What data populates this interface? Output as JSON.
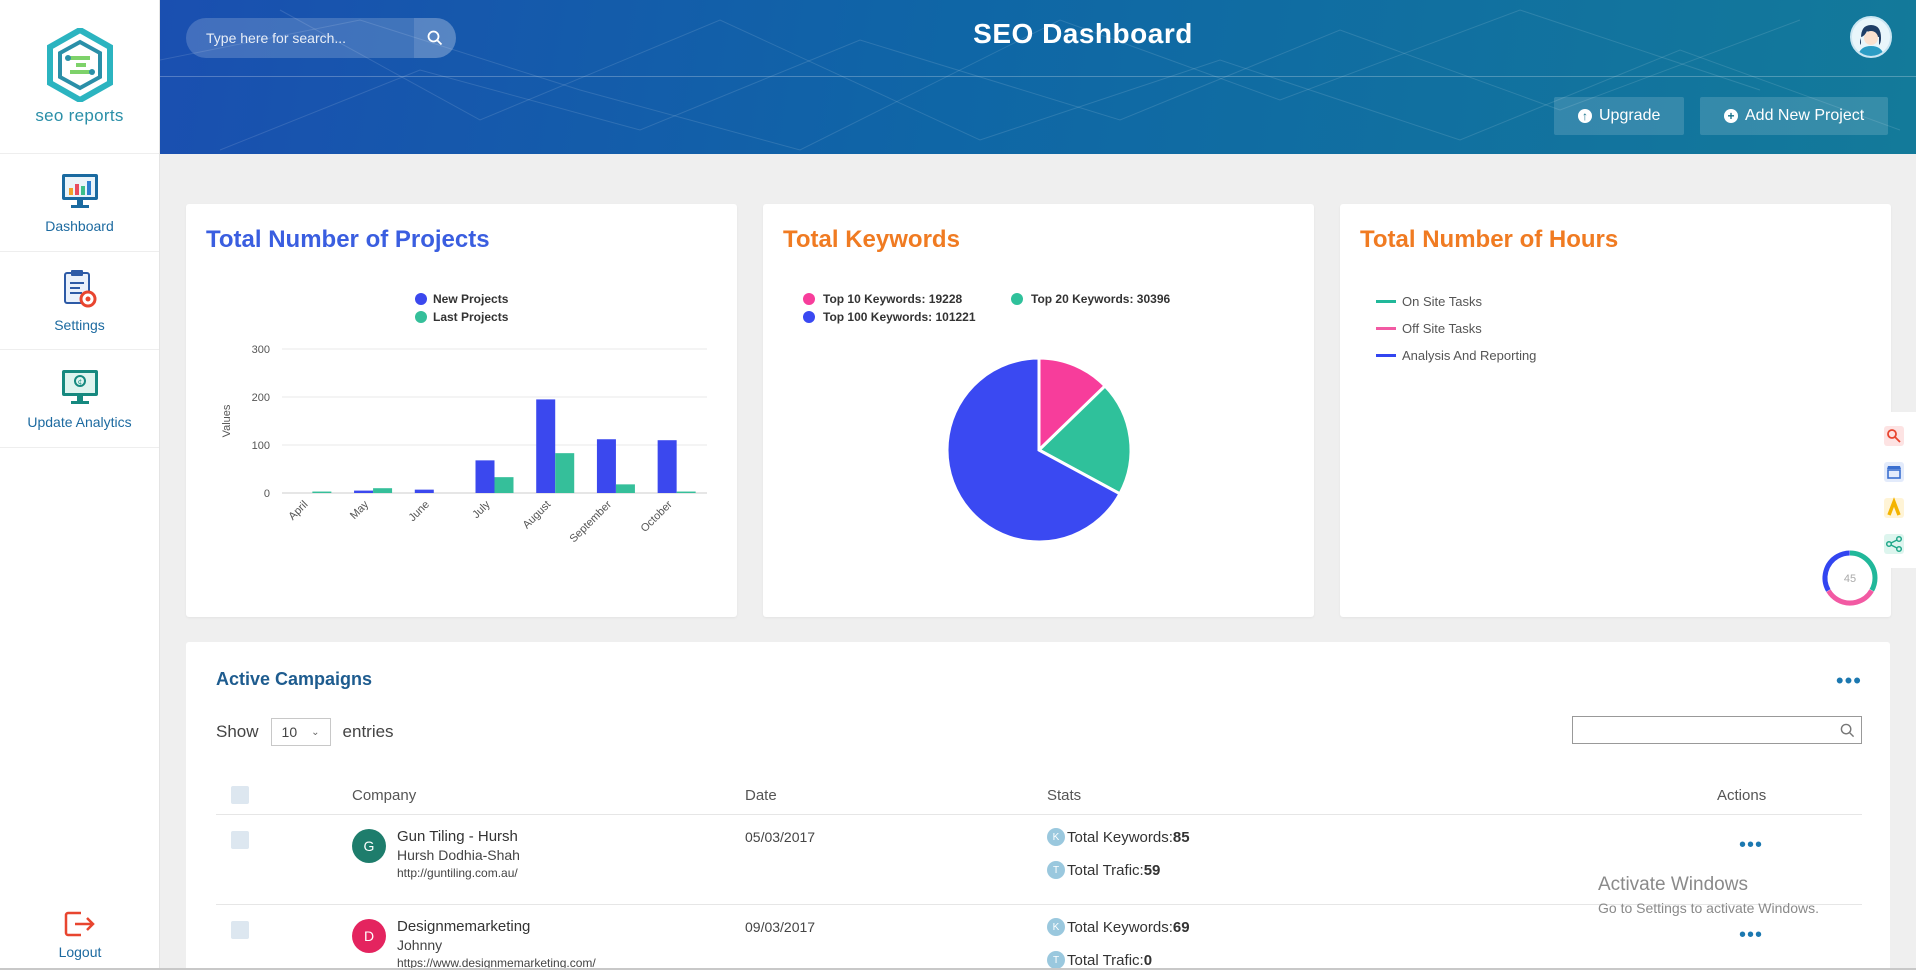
{
  "app": {
    "logo_text": "seo reports",
    "title": "SEO Dashboard"
  },
  "sidebar": {
    "items": [
      {
        "label": "Dashboard",
        "icon": "monitor-chart-icon"
      },
      {
        "label": "Settings",
        "icon": "settings-doc-icon"
      },
      {
        "label": "Update Analytics",
        "icon": "analytics-monitor-icon"
      }
    ],
    "logout": "Logout"
  },
  "header": {
    "search_placeholder": "Type here for search...",
    "upgrade_label": "Upgrade",
    "add_project_label": "Add New Project"
  },
  "cards": {
    "projects": {
      "title": "Total Number of Projects",
      "color": "#3a5ee0"
    },
    "keywords": {
      "title": "Total Keywords",
      "color": "#f07b22"
    },
    "hours": {
      "title": "Total Number of Hours",
      "color": "#f07b22",
      "legend": [
        {
          "label": "On Site Tasks",
          "color": "#21b89a"
        },
        {
          "label": "Off Site Tasks",
          "color": "#f25aa3"
        },
        {
          "label": "Analysis And Reporting",
          "color": "#3245f0"
        }
      ]
    }
  },
  "chart_data": [
    {
      "type": "bar",
      "categories": [
        "April",
        "May",
        "June",
        "July",
        "August",
        "September",
        "October"
      ],
      "series": [
        {
          "name": "New Projects",
          "color": "#3b48ee",
          "values": [
            0,
            5,
            7,
            68,
            195,
            112,
            110
          ]
        },
        {
          "name": "Last Projects",
          "color": "#35bf9a",
          "values": [
            3,
            10,
            0,
            33,
            83,
            18,
            3
          ]
        }
      ],
      "xlabel": "",
      "ylabel": "Values",
      "yticks": [
        0,
        100,
        200,
        300
      ],
      "ylim": [
        0,
        300
      ],
      "grid": true,
      "legend_position": "top-center"
    },
    {
      "type": "pie",
      "slices": [
        {
          "name": "Top 10 Keywords",
          "value": 19228,
          "color": "#f73d9b"
        },
        {
          "name": "Top 20 Keywords",
          "value": 30396,
          "color": "#2fc19b"
        },
        {
          "name": "Top 100 Keywords",
          "value": 101221,
          "color": "#3a49f2"
        }
      ],
      "legend_labels": [
        "Top 10 Keywords: 19228",
        "Top 20 Keywords: 30396",
        "Top 100 Keywords: 101221"
      ],
      "legend_position": "top-left"
    }
  ],
  "campaigns": {
    "title": "Active Campaigns",
    "show_label": "Show",
    "entries_value": "10",
    "entries_label": "entries",
    "columns": [
      "Company",
      "Date",
      "Stats",
      "Actions"
    ],
    "rows": [
      {
        "initial": "G",
        "avatar_color": "#1e7d6c",
        "company": "Gun Tiling - Hursh",
        "person": "Hursh Dodhia-Shah",
        "url": "http://guntiling.com.au/",
        "date": "05/03/2017",
        "keywords_label": "Total Keywords:",
        "keywords": "85",
        "traffic_label": "Total Trafic:",
        "traffic": "59"
      },
      {
        "initial": "D",
        "avatar_color": "#e4245f",
        "company": "Designmemarketing",
        "person": "Johnny",
        "url": "https://www.designmemarketing.com/",
        "date": "09/03/2017",
        "keywords_label": "Total Keywords:",
        "keywords": "69",
        "traffic_label": "Total Trafic:",
        "traffic": "0"
      }
    ],
    "stat_badge_k": "K",
    "stat_badge_t": "T"
  },
  "ring_value": "45",
  "watermark": {
    "line1": "Activate Windows",
    "line2": "Go to Settings to activate Windows."
  }
}
